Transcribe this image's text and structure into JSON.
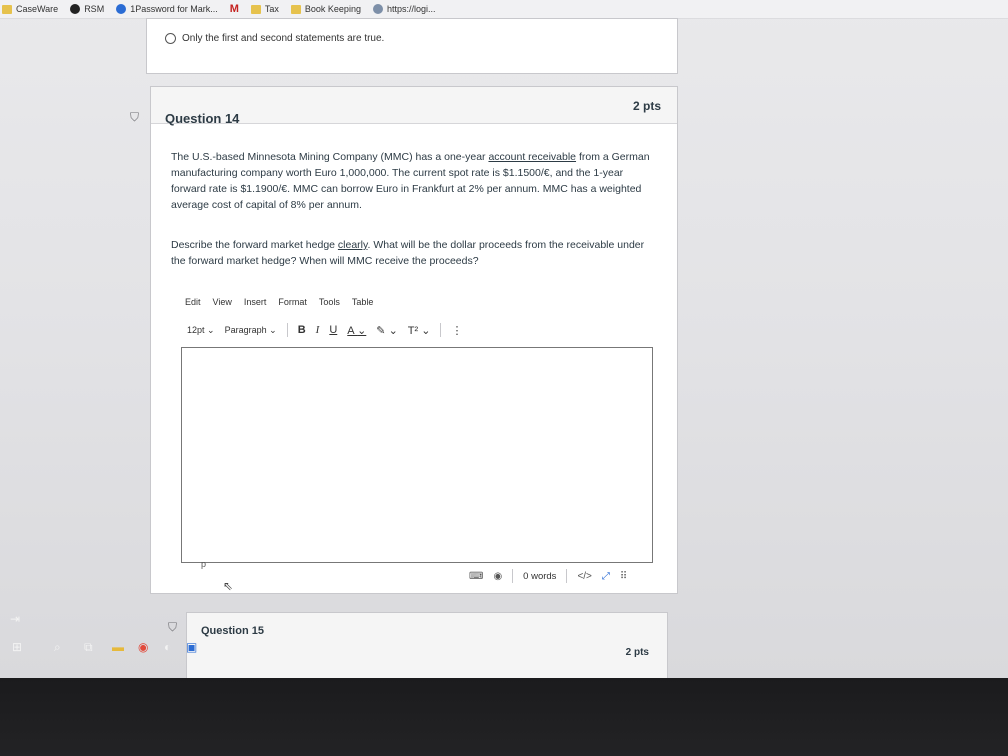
{
  "bookmarks": [
    {
      "label": "CaseWare",
      "icon": "folder-icon"
    },
    {
      "label": "RSM",
      "icon": "rsm-icon"
    },
    {
      "label": "1Password for Mark...",
      "icon": "onepassword-icon"
    },
    {
      "label": "",
      "icon": "gmail-icon"
    },
    {
      "label": "Tax",
      "icon": "folder-icon"
    },
    {
      "label": "Book Keeping",
      "icon": "folder-icon"
    },
    {
      "label": "https://logi...",
      "icon": "globe-icon"
    }
  ],
  "previous_question": {
    "option_label": "Only the first and second statements are true."
  },
  "question14": {
    "title": "Question 14",
    "points": "2 pts",
    "paragraph1_a": "The U.S.-based Minnesota Mining Company (MMC) has a one-year ",
    "paragraph1_link": "account receivable",
    "paragraph1_b": " from a German manufacturing company worth Euro 1,000,000. The current spot rate is $1.1500/€, and the 1-year forward rate is $1.1900/€. MMC can borrow Euro in Frankfurt at 2% per annum. MMC has a weighted average cost of capital of 8% per annum.",
    "paragraph2_a": "Describe the forward market hedge ",
    "paragraph2_link": "clearly",
    "paragraph2_b": ". What will be the dollar proceeds from the receivable under the forward market hedge? When will MMC receive the proceeds?"
  },
  "editor": {
    "menu": [
      "Edit",
      "View",
      "Insert",
      "Format",
      "Tools",
      "Table"
    ],
    "font_size": "12pt",
    "block_format": "Paragraph",
    "bold": "B",
    "italic": "I",
    "underline": "U",
    "text_color": "A",
    "highlight": "✎",
    "superscript": "T²",
    "more": "⋮",
    "path_label": "p",
    "word_count": "0 words",
    "html_toggle": "</>",
    "expand": "⤢",
    "resize": "⠿"
  },
  "question15": {
    "title": "Question 15",
    "points": "2 pts"
  },
  "colors": {
    "heading_text": "#2d3b45",
    "card_border": "#c8c8cc"
  }
}
